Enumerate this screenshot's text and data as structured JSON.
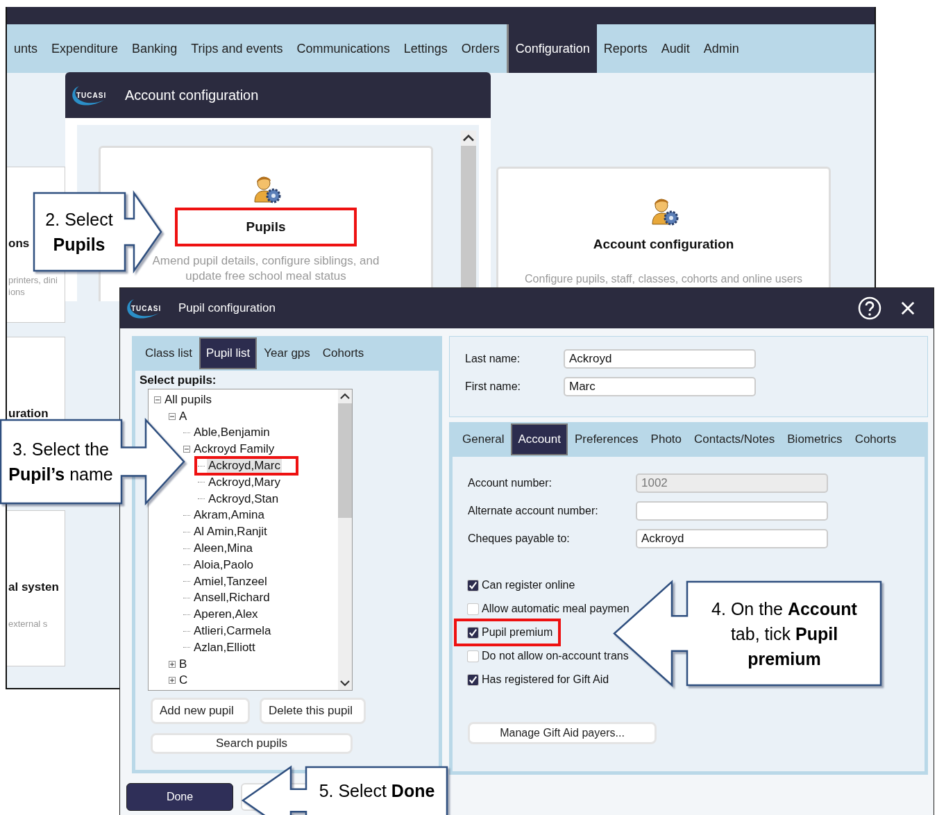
{
  "back_window": {
    "menu": [
      {
        "label": "unts",
        "selected": false
      },
      {
        "label": "Expenditure",
        "selected": false
      },
      {
        "label": "Banking",
        "selected": false
      },
      {
        "label": "Trips and events",
        "selected": false
      },
      {
        "label": "Communications",
        "selected": false
      },
      {
        "label": "Lettings",
        "selected": false
      },
      {
        "label": "Orders",
        "selected": false
      },
      {
        "label": "Configuration",
        "selected": true
      },
      {
        "label": "Reports",
        "selected": false
      },
      {
        "label": "Audit",
        "selected": false
      },
      {
        "label": "Admin",
        "selected": false
      }
    ],
    "side_cards": [
      {
        "texts": [
          {
            "kind": "title",
            "text": "ons"
          },
          {
            "kind": "desc",
            "text": "printers, dini"
          },
          {
            "kind": "desc",
            "text": "ions"
          }
        ]
      },
      {
        "texts": [
          {
            "kind": "title",
            "text": "uration"
          }
        ]
      },
      {
        "texts": [
          {
            "kind": "title",
            "text": "al systen"
          },
          {
            "kind": "desc",
            "text": "external s"
          }
        ]
      }
    ],
    "config_window": {
      "logo": "TUCASI",
      "title": "Account configuration",
      "card": {
        "title": "Pupils",
        "highlighted": true,
        "description": "Amend pupil details, configure siblings, and update free school meal status"
      }
    },
    "right_card": {
      "title": "Account configuration",
      "description": "Configure pupils, staff, classes, cohorts and online users"
    }
  },
  "pupil_window": {
    "logo": "TUCASI",
    "title": "Pupil configuration",
    "list_tabs": [
      {
        "label": "Class list",
        "selected": false
      },
      {
        "label": "Pupil list",
        "selected": true
      },
      {
        "label": "Year gps",
        "selected": false
      },
      {
        "label": "Cohorts",
        "selected": false
      }
    ],
    "select_label": "Select pupils:",
    "tree": [
      {
        "label": "All pupils",
        "expanded": true,
        "children": [
          {
            "label": "A",
            "expanded": true,
            "children": [
              {
                "label": "Able,Benjamin",
                "selected": false
              },
              {
                "label": "Ackroyd Family",
                "expanded": true,
                "children": [
                  {
                    "label": "Ackroyd,Marc",
                    "selected": true
                  },
                  {
                    "label": "Ackroyd,Mary",
                    "selected": false
                  },
                  {
                    "label": "Ackroyd,Stan",
                    "selected": false
                  }
                ]
              },
              {
                "label": "Akram,Amina",
                "selected": false
              },
              {
                "label": "Al Amin,Ranjit",
                "selected": false
              },
              {
                "label": "Aleen,Mina",
                "selected": false
              },
              {
                "label": "Aloia,Paolo",
                "selected": false
              },
              {
                "label": "Amiel,Tanzeel",
                "selected": false
              },
              {
                "label": "Ansell,Richard",
                "selected": false
              },
              {
                "label": "Aperen,Alex",
                "selected": false
              },
              {
                "label": "Atlieri,Carmela",
                "selected": false
              },
              {
                "label": "Azlan,Elliott",
                "selected": false
              }
            ]
          },
          {
            "label": "B",
            "expanded": false
          },
          {
            "label": "C",
            "expanded": false
          }
        ]
      }
    ],
    "list_buttons": [
      "Add new pupil",
      "Delete this pupil",
      "Search pupils"
    ],
    "name_fields": [
      {
        "label": "Last name:",
        "value": "Ackroyd"
      },
      {
        "label": "First name:",
        "value": "Marc"
      }
    ],
    "detail_tabs": [
      {
        "label": "General",
        "selected": false
      },
      {
        "label": "Account",
        "selected": true
      },
      {
        "label": "Preferences",
        "selected": false
      },
      {
        "label": "Photo",
        "selected": false
      },
      {
        "label": "Contacts/Notes",
        "selected": false
      },
      {
        "label": "Biometrics",
        "selected": false
      },
      {
        "label": "Cohorts",
        "selected": false
      }
    ],
    "account_fields": [
      {
        "label": "Account number:",
        "value": "1002",
        "disabled": true
      },
      {
        "label": "Alternate account number:",
        "disabled": false
      },
      {
        "label": "Cheques payable to:",
        "value": "Ackroyd",
        "disabled": false
      }
    ],
    "checkboxes": [
      {
        "label": "Can register online",
        "checked": true,
        "highlighted": false
      },
      {
        "label": "Allow automatic meal paymen",
        "checked": false,
        "highlighted": false
      },
      {
        "label": "Pupil premium",
        "checked": true,
        "highlighted": true
      },
      {
        "label": "Do not allow on-account trans",
        "checked": false,
        "highlighted": false
      },
      {
        "label": "Has registered for Gift Aid",
        "checked": true,
        "highlighted": false
      }
    ],
    "manage_button": "Manage Gift Aid payers...",
    "footer_buttons": [
      {
        "kind": "primary",
        "label": "Done"
      },
      {
        "kind": "secondary"
      }
    ]
  },
  "callouts": [
    {
      "text": "2. Select\n**Pupils**"
    },
    {
      "text": "3. Select the\n**Pupil’s** name"
    },
    {
      "text": "4. On the **Account**\ntab, tick **Pupil**\n**premium**"
    },
    {
      "text": "5. Select **Done**"
    }
  ]
}
